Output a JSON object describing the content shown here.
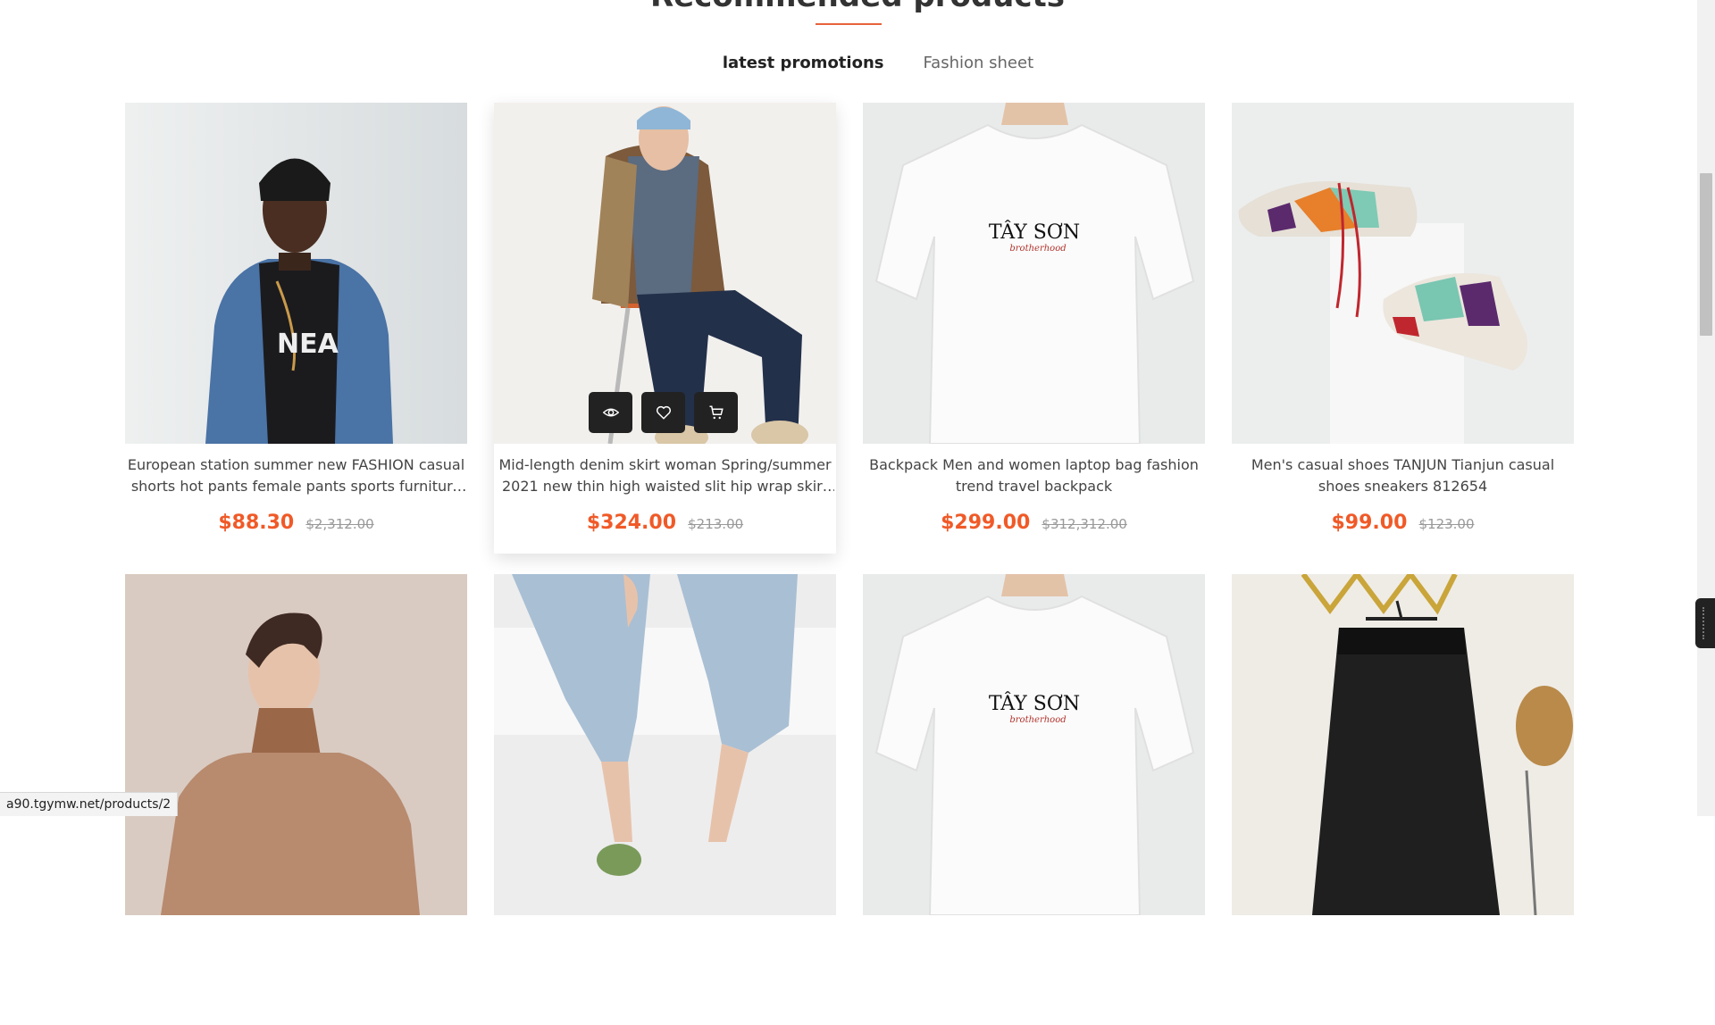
{
  "section": {
    "title": "Recommended products",
    "tabs": [
      {
        "label": "latest promotions",
        "active": true
      },
      {
        "label": "Fashion sheet",
        "active": false
      }
    ]
  },
  "products": [
    {
      "name": "European station summer new FASHION casual shorts hot pants female pants sports furniture shorts",
      "price": "$88.30",
      "old_price": "$2,312.00",
      "image": "man-denim-jacket"
    },
    {
      "name": "Mid-length denim skirt woman Spring/summer 2021 new thin high waisted slit hip wrap skirt A-line",
      "price": "$324.00",
      "old_price": "$213.00",
      "image": "woman-plaid-shirt"
    },
    {
      "name": "Backpack Men and women laptop bag fashion trend travel backpack",
      "price": "$299.00",
      "old_price": "$312,312.00",
      "image": "white-tshirt"
    },
    {
      "name": "Men's casual shoes TANJUN Tianjun casual shoes sneakers 812654",
      "price": "$99.00",
      "old_price": "$123.00",
      "image": "sneakers"
    },
    {
      "name": "",
      "price": "",
      "old_price": "",
      "image": "man-turtleneck"
    },
    {
      "name": "",
      "price": "",
      "old_price": "",
      "image": "jeans-heels"
    },
    {
      "name": "",
      "price": "",
      "old_price": "",
      "image": "white-tshirt"
    },
    {
      "name": "",
      "price": "",
      "old_price": "",
      "image": "black-skirt"
    }
  ],
  "tshirt_print": {
    "brand": "TÂY SƠN",
    "tagline": "brotherhood"
  },
  "hover_actions": [
    {
      "icon": "eye-icon"
    },
    {
      "icon": "heart-icon"
    },
    {
      "icon": "cart-icon"
    }
  ],
  "status_bar": {
    "url": "a90.tgymw.net/products/2"
  },
  "colors": {
    "accent": "#f05a28",
    "underline": "#e8633a",
    "action_bg": "#222222"
  }
}
